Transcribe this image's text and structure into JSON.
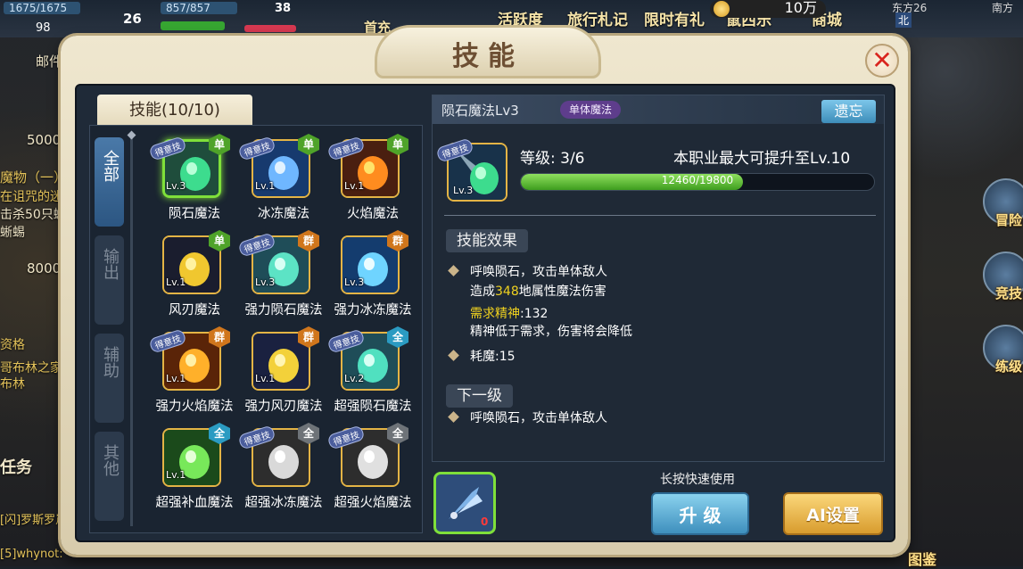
{
  "hud": {
    "hp_1": "1675/1675",
    "hp_2": "857/857",
    "level_1": "26",
    "level_2": "38",
    "val_98": "98",
    "mail": "邮件",
    "menus": [
      "首充",
      "活跃度",
      "旅行札记",
      "限时有礼",
      "鼠西乐",
      "商城"
    ],
    "gold": "10万",
    "direction": "东方26",
    "direction_2": "北",
    "south": "南方"
  },
  "left_hud": {
    "currency_1": "5000",
    "currency_2": "8000",
    "quest_title": "魔物（一）",
    "quest_lines": [
      "在诅咒的迷宫",
      "击杀50只蜥",
      "蜥蜴"
    ],
    "quest_2_title": "资格",
    "quest_2_lines": [
      "哥布林之家",
      "布林"
    ],
    "task": "任务",
    "chat_1": "[闪]罗斯罗岚",
    "chat_2": "[5]whynot:"
  },
  "right_hud": {
    "btn_1": "冒险",
    "btn_2": "竞技",
    "btn_3": "练级",
    "btn_4": "图鉴"
  },
  "dialog": {
    "title": "技能",
    "close": "✕",
    "skills_tab": "技能(10/10)",
    "categories": [
      "全部",
      "输出",
      "辅助",
      "其他"
    ]
  },
  "skills": [
    {
      "name": "陨石魔法",
      "lv": "Lv.3",
      "type": "单",
      "tag": "得意技"
    },
    {
      "name": "冰冻魔法",
      "lv": "Lv.1",
      "type": "单",
      "tag": "得意技"
    },
    {
      "name": "火焰魔法",
      "lv": "Lv.1",
      "type": "单",
      "tag": "得意技"
    },
    {
      "name": "风刃魔法",
      "lv": "Lv.1",
      "type": "单",
      "tag": ""
    },
    {
      "name": "强力陨石魔法",
      "lv": "Lv.3",
      "type": "群",
      "tag": "得意技"
    },
    {
      "name": "强力冰冻魔法",
      "lv": "Lv.3",
      "type": "群",
      "tag": ""
    },
    {
      "name": "强力火焰魔法",
      "lv": "Lv.1",
      "type": "群",
      "tag": "得意技"
    },
    {
      "name": "强力风刃魔法",
      "lv": "Lv.1",
      "type": "群",
      "tag": ""
    },
    {
      "name": "超强陨石魔法",
      "lv": "Lv.2",
      "type": "全",
      "tag": "得意技"
    },
    {
      "name": "超强补血魔法",
      "lv": "Lv.1",
      "type": "全",
      "tag": ""
    },
    {
      "name": "超强冰冻魔法",
      "lv": "",
      "type": "全",
      "tag": "得意技"
    },
    {
      "name": "超强火焰魔法",
      "lv": "",
      "type": "全",
      "tag": "得意技"
    }
  ],
  "detail": {
    "name": "陨石魔法Lv3",
    "type": "单体魔法",
    "forget": "遗忘",
    "icon_lv": "Lv.3",
    "icon_tag": "得意技",
    "level_label": "等级: 3/6",
    "max_level": "本职业最大可提升至Lv.10",
    "xp_text": "12460/19800",
    "xp_fraction": 0.629,
    "effect_title": "技能效果",
    "effect_line1": "呼唤陨石，攻击单体敌人",
    "effect_line2_pre": "造成",
    "effect_line2_num": "348",
    "effect_line2_post": "地属性魔法伤害",
    "need_label": "需求精神",
    "need_value": ":132",
    "effect_line4": "精神低于需求，伤害将会降低",
    "mana": "耗魔:15",
    "next_title": "下一级",
    "next_line1": "呼唤陨石，攻击单体敌人"
  },
  "bottom": {
    "hint": "长按快速使用",
    "quick_count": "0",
    "upgrade": "升 级",
    "ai": "AI设置"
  },
  "colors": {
    "highlight": "#f0d21f",
    "single": "#4fa329",
    "group": "#d0761c",
    "all": "#2b9bc2"
  }
}
